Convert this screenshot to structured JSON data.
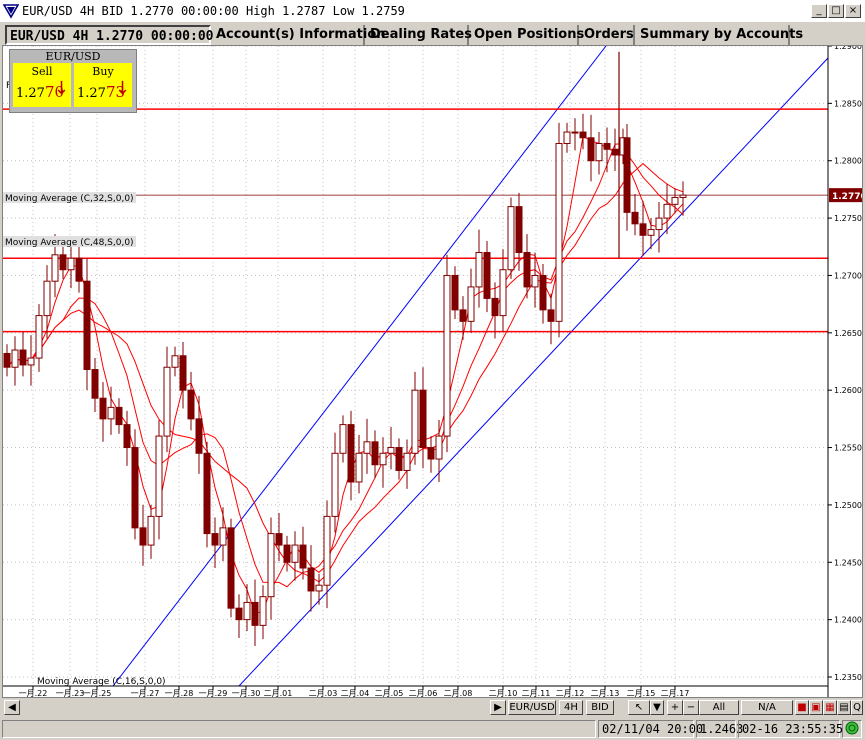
{
  "window": {
    "title": "EUR/USD 4H BID 1.2770 00:00:00 High 1.2787 Low 1.2759",
    "controls": [
      "_",
      "□",
      "×"
    ]
  },
  "tabs": [
    {
      "label": "EUR/USD 4H 1.2770 00:00:00",
      "active": true
    },
    {
      "label": "Account(s) Information",
      "active": false
    },
    {
      "label": "Dealing Rates",
      "active": false
    },
    {
      "label": "Open Positions",
      "active": false
    },
    {
      "label": "Orders",
      "active": false
    },
    {
      "label": "Summary by Accounts",
      "active": false
    }
  ],
  "quote": {
    "symbol": "EUR/USD",
    "sell": {
      "label": "Sell",
      "big": "1.27",
      "pips": "70",
      "arrow": "↓"
    },
    "buy": {
      "label": "Buy",
      "big": "1.27",
      "pips": "73",
      "arrow": "↓"
    },
    "overflow_char": "F"
  },
  "indicators": {
    "ma32": "Moving Average (C,32,S,0,0)",
    "ma48": "Moving Average (C,48,S,0,0)",
    "ma16": "Moving Average (C,16,S,0,0)"
  },
  "chart": {
    "price_labels": [
      "1.2900",
      "1.2850",
      "1.2800",
      "1.2750",
      "1.2700",
      "1.2650",
      "1.2600",
      "1.2550",
      "1.2500",
      "1.2450",
      "1.2400",
      "1.2350"
    ],
    "price_values": [
      1.29,
      1.285,
      1.28,
      1.275,
      1.27,
      1.265,
      1.26,
      1.255,
      1.25,
      1.245,
      1.24,
      1.235
    ],
    "current_price": "1.2770",
    "current_value": 1.277,
    "date_labels": [
      "一月.22",
      "一月.23",
      "一月.25",
      "一月.27",
      "一月.28",
      "一月.29",
      "一月.30",
      "二月.01",
      "二月.03",
      "二月.04",
      "二月.05",
      "二月.06",
      "二月.08",
      "二月.10",
      "二月.11",
      "二月.12",
      "二月.13",
      "二月.15",
      "二月.17"
    ],
    "horizontal_lines": [
      1.2845,
      1.2715,
      1.2651
    ],
    "colors": {
      "candle": "#800000",
      "support": "#ff0000",
      "channel": "#0000ff",
      "ma": "#ff0000",
      "grid": "#c0c0c0",
      "price_tag": "#800000"
    }
  },
  "scrollbar": {
    "symbol_button": "EUR/USD",
    "period_button": "4H",
    "side_button": "BID",
    "all_button": "All",
    "na_button": "N/A"
  },
  "status": {
    "datetime": "02/11/04 20:00",
    "price": "1.2463",
    "clock": "02-16 23:55:35"
  }
}
